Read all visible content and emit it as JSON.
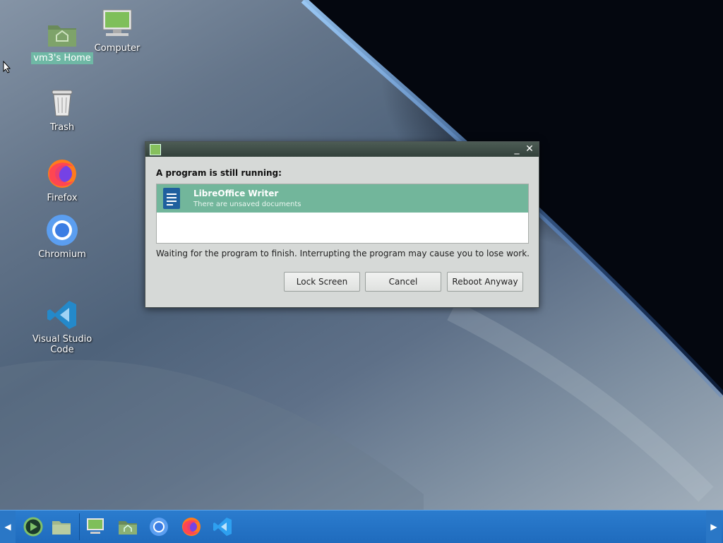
{
  "desktop": {
    "icons": [
      {
        "label": "vm3's Home",
        "icon": "home-folder-icon"
      },
      {
        "label": "Computer",
        "icon": "computer-icon"
      },
      {
        "label": "Trash",
        "icon": "trash-icon"
      },
      {
        "label": "Firefox",
        "icon": "firefox-icon"
      },
      {
        "label": "Chromium",
        "icon": "chromium-icon"
      },
      {
        "label": "Visual Studio Code",
        "icon": "vscode-icon"
      }
    ]
  },
  "dialog": {
    "heading": "A program is still running:",
    "process": {
      "name": "LibreOffice Writer",
      "status": "There are unsaved documents",
      "icon": "libreoffice-writer-icon"
    },
    "message": "Waiting for the program to finish.  Interrupting the program may cause you to lose work.",
    "buttons": {
      "lock": "Lock Screen",
      "cancel": "Cancel",
      "reboot": "Reboot Anyway"
    },
    "titlebar": {
      "minimize": "_",
      "close": "✕"
    }
  },
  "taskbar": {
    "left_arrow": "◀",
    "right_arrow": "▶",
    "launchers": [
      "start-menu-icon",
      "file-manager-icon",
      "computer-icon",
      "home-folder-icon",
      "chromium-icon",
      "firefox-icon",
      "vscode-icon"
    ]
  },
  "colors": {
    "selection": "#72b69b",
    "taskbar": "#2476c8",
    "titlebar": "#3c4a44"
  }
}
